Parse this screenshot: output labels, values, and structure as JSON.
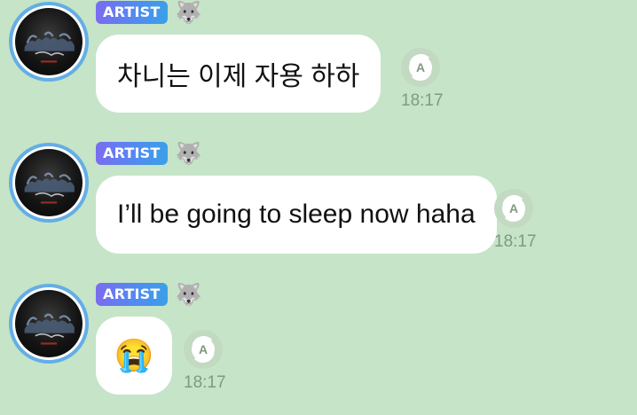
{
  "colors": {
    "background": "#c6e4c8",
    "bubble": "#ffffff",
    "badge_gradient_start": "#7a6cf0",
    "badge_gradient_end": "#3aa0e8",
    "avatar_ring": "#64aee6",
    "timestamp": "#7f9a80"
  },
  "messages": [
    {
      "sender": {
        "badge": "ARTIST",
        "emoji": "🐺"
      },
      "text": "차니는 이제 자용 하하",
      "time": "18:17",
      "translate_icon": "translate-icon"
    },
    {
      "sender": {
        "badge": "ARTIST",
        "emoji": "🐺"
      },
      "text": "I’ll be going to sleep now haha",
      "time": "18:17",
      "translate_icon": "translate-icon"
    },
    {
      "sender": {
        "badge": "ARTIST",
        "emoji": "🐺"
      },
      "text": "😭",
      "time": "18:17",
      "translate_icon": "translate-icon"
    }
  ]
}
